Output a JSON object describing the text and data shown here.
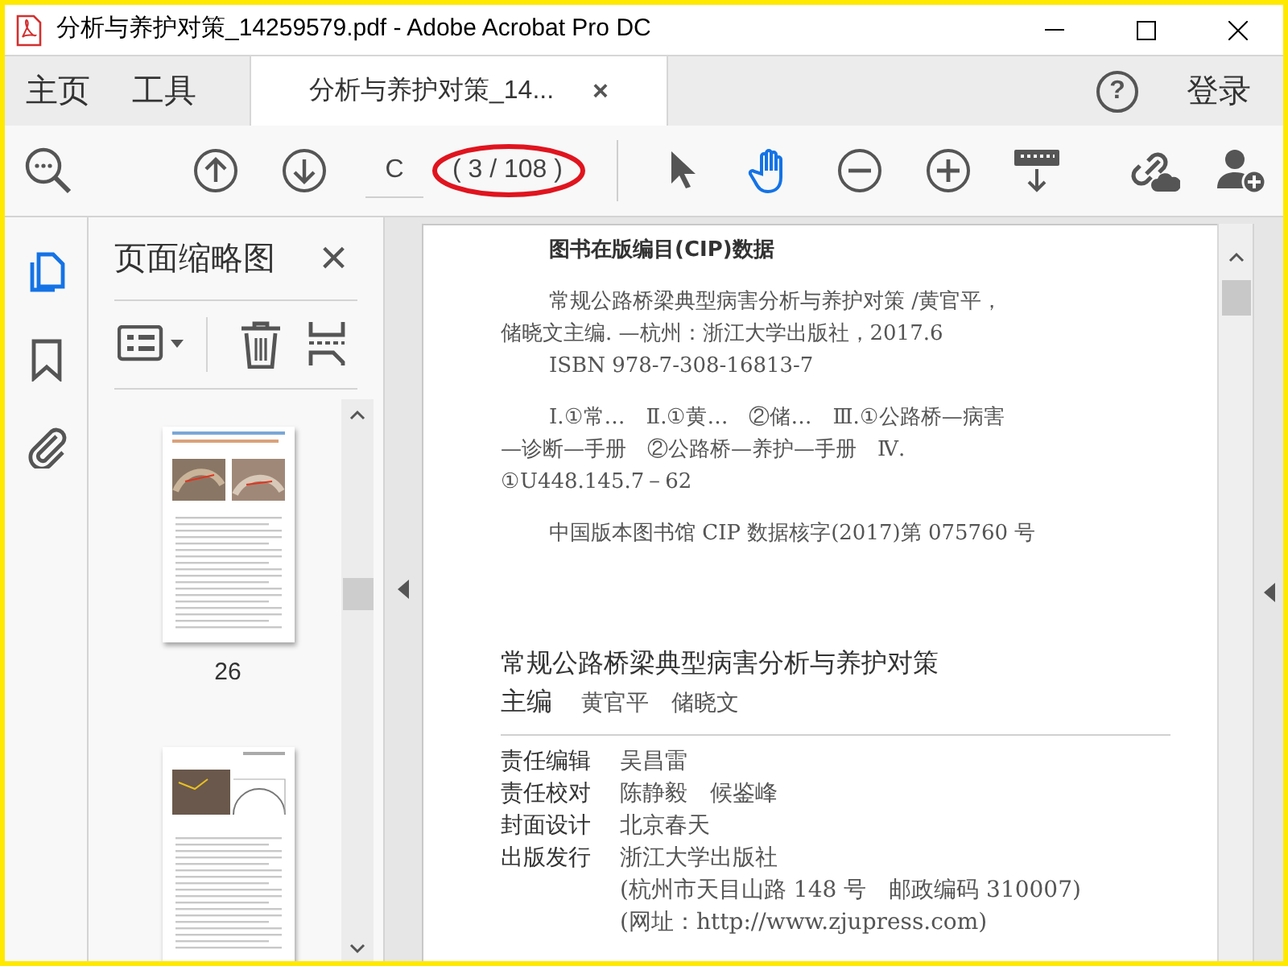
{
  "window": {
    "title": "分析与养护对策_14259579.pdf - Adobe Acrobat Pro DC"
  },
  "nav_tabs": [
    {
      "label": "主页",
      "selected": false
    },
    {
      "label": "工具",
      "selected": false
    },
    {
      "label": "分析与养护对策_14...",
      "selected": true,
      "close": "×"
    }
  ],
  "account": {
    "label": "登录",
    "help": "?"
  },
  "toolbar": {
    "page_field": {
      "value": "C"
    },
    "page_count": "( 3 / 108 )",
    "tools": [
      {
        "kind": "select",
        "selected": false
      },
      {
        "kind": "hand",
        "selected": true
      },
      {
        "kind": "zoom-out",
        "selected": false
      },
      {
        "kind": "zoom-in",
        "selected": false
      },
      {
        "kind": "keyboard",
        "selected": false
      }
    ]
  },
  "sidebar": {
    "rail": [
      {
        "kind": "pages",
        "selected": true
      },
      {
        "kind": "bookmark",
        "selected": false
      },
      {
        "kind": "attachment",
        "selected": false
      }
    ],
    "panel": {
      "title": "页面缩略图",
      "close": "×",
      "thumbnails": [
        {
          "kind": "photos",
          "label": "26"
        },
        {
          "kind": "arch"
        }
      ]
    }
  },
  "document": {
    "cip": {
      "heading": "图书在版编目(CIP)数据",
      "blocks": [
        [
          {
            "text": "常规公路桥梁典型病害分析与养护对策 /黄官平，",
            "indent": true
          },
          {
            "text": "储晓文主编. —杭州：浙江大学出版社，2017.6",
            "indent": false
          },
          {
            "text": "ISBN 978-7-308-16813-7",
            "indent": true
          }
        ],
        [
          {
            "text": "Ⅰ.①常…　Ⅱ.①黄…　②储…　Ⅲ.①公路桥—病害",
            "indent": true
          },
          {
            "text": "—诊断—手册　②公路桥—养护—手册　Ⅳ.",
            "indent": false
          },
          {
            "text": "①U448.145.7－62",
            "indent": false
          }
        ],
        [
          {
            "text": "中国版本图书馆 CIP 数据核字(2017)第 075760 号",
            "indent": true
          }
        ]
      ]
    },
    "book_title": "常规公路桥梁典型病害分析与养护对策",
    "editor": {
      "label": "主编",
      "value": "黄官平　储晓文"
    },
    "credits": [
      {
        "label": "责任编辑",
        "value": "吴昌雷"
      },
      {
        "label": "责任校对",
        "value": "陈静毅　候鉴峰"
      },
      {
        "label": "封面设计",
        "value": "北京春天"
      },
      {
        "label": "出版发行",
        "value": "浙江大学出版社"
      },
      {
        "value": "(杭州市天目山路 148 号　邮政编码 310007)"
      },
      {
        "value": "(网址：http://www.zjupress.com)"
      }
    ]
  }
}
